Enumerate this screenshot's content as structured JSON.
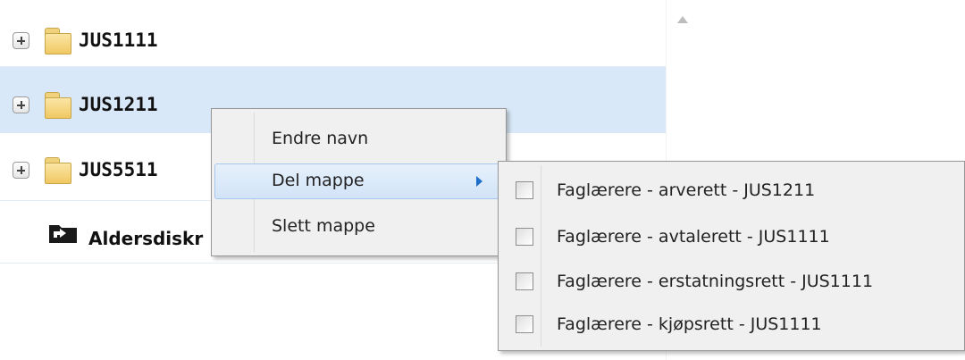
{
  "tree": {
    "folders": [
      {
        "label": "JUS1111"
      },
      {
        "label": "JUS1211"
      },
      {
        "label": "JUS5511"
      }
    ],
    "shared_item": {
      "label": "Aldersdiskr",
      "icon": "shared-folder-icon"
    }
  },
  "context_menu": {
    "items": [
      {
        "label": "Endre navn"
      },
      {
        "label": "Del mappe"
      },
      {
        "label": "Slett mappe"
      }
    ]
  },
  "share_submenu": {
    "items": [
      {
        "label": "Faglærere - arverett - JUS1211",
        "checked": false
      },
      {
        "label": "Faglærere - avtalerett - JUS1111",
        "checked": false
      },
      {
        "label": "Faglærere - erstatningsrett - JUS1111",
        "checked": false
      },
      {
        "label": "Faglærere - kjøpsrett - JUS1111",
        "checked": false
      }
    ]
  },
  "colors": {
    "selected_row": "#d9e8f8",
    "menu_background": "#f0f0f0",
    "submenu_arrow": "#1e6fc9"
  }
}
